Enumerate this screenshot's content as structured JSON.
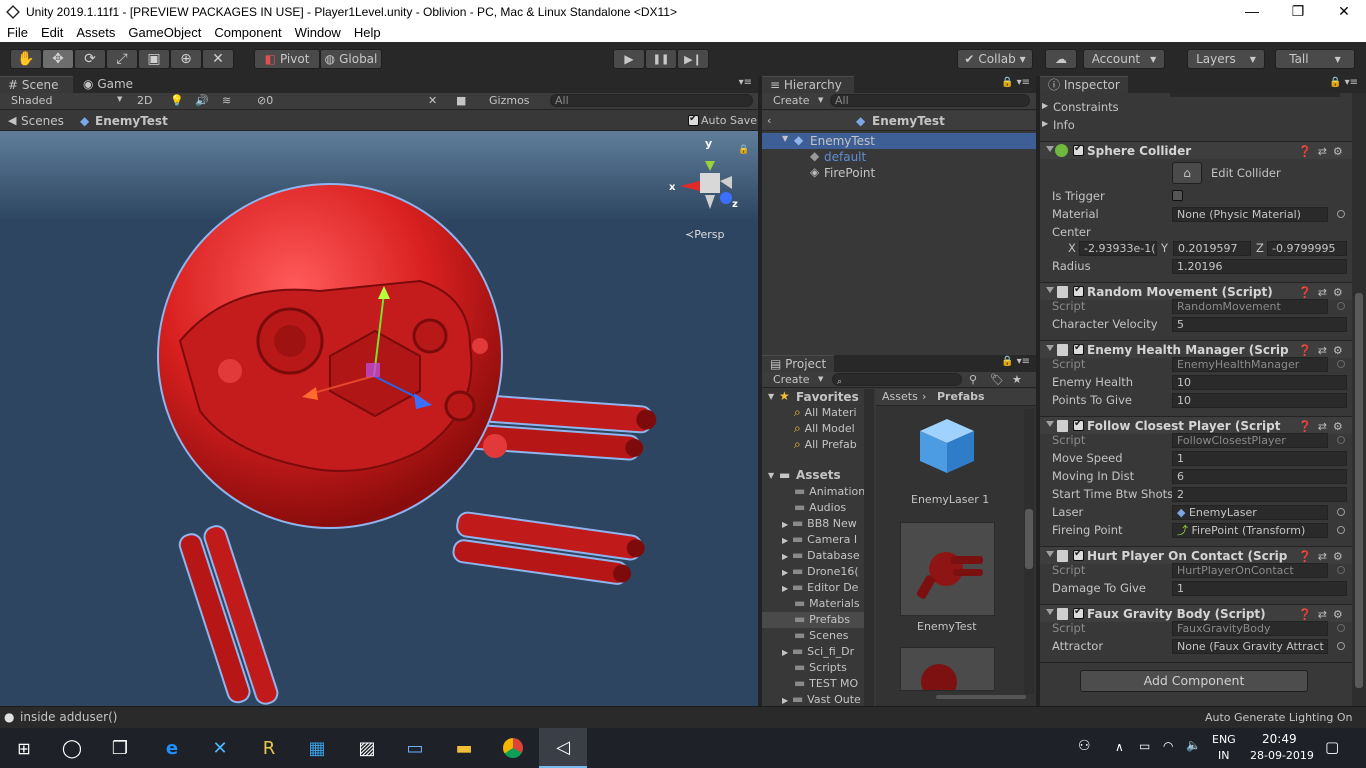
{
  "window": {
    "title": "Unity 2019.1.11f1 - [PREVIEW PACKAGES IN USE] - Player1Level.unity - Oblivion - PC, Mac & Linux Standalone <DX11>",
    "minimize": "—",
    "restore": "❐",
    "close": "✕"
  },
  "menu": [
    "File",
    "Edit",
    "Assets",
    "GameObject",
    "Component",
    "Window",
    "Help"
  ],
  "toolbar": {
    "pivot": "Pivot",
    "global": "Global",
    "collab": "Collab ▾",
    "account": "Account",
    "layers": "Layers",
    "layout": "Tall",
    "play": "▶",
    "pause": "❚❚",
    "step": "▶❙"
  },
  "scene": {
    "tab_scene": "Scene",
    "tab_game": "Game",
    "shading": "Shaded",
    "mode_2d": "2D",
    "hidden_count": "0",
    "gizmos": "Gizmos",
    "search_placeholder": "All",
    "breadcrumb_scenes": "Scenes",
    "breadcrumb_object": "EnemyTest",
    "auto_save": "Auto Save",
    "persp": "Persp",
    "axis_y": "y",
    "axis_x": "x",
    "axis_z": "z"
  },
  "hierarchy": {
    "tab": "Hierarchy",
    "create": "Create",
    "search_placeholder": "All",
    "header": "EnemyTest",
    "items": [
      {
        "label": "EnemyTest",
        "color": "#8fb4ee"
      },
      {
        "label": "default",
        "color": "#5e8fd6"
      },
      {
        "label": "FirePoint",
        "color": "#c4c4c4"
      }
    ]
  },
  "project": {
    "tab": "Project",
    "create": "Create",
    "favorites": "Favorites",
    "favorite_items": [
      "All Materi",
      "All Model",
      "All Prefab"
    ],
    "assets": "Assets",
    "folders": [
      "Animation",
      "Audios",
      "BB8 New",
      "Camera I",
      "Database",
      "Drone16(",
      "Editor De",
      "Materials",
      "Prefabs",
      "Scenes",
      "Sci_fi_Dr",
      "Scripts",
      "TEST MO",
      "Vast Oute"
    ],
    "path": [
      "Assets",
      "Prefabs"
    ],
    "grid_items": [
      "EnemyLaser 1",
      "EnemyTest"
    ]
  },
  "inspector": {
    "tab": "Inspector",
    "top_items": [
      "Constraints",
      "Info"
    ],
    "sphere": {
      "title": "Sphere Collider",
      "edit_collider": "Edit Collider",
      "is_trigger": "Is Trigger",
      "material_label": "Material",
      "material_value": "None (Physic Material)",
      "center_label": "Center",
      "x": "-2.93933e-1(",
      "y": "0.2019597",
      "z": "-0.9799995",
      "radius_label": "Radius",
      "radius_value": "1.20196"
    },
    "random_movement": {
      "title": "Random Movement (Script)",
      "script": "RandomMovement",
      "velocity_label": "Character Velocity",
      "velocity": "5"
    },
    "health": {
      "title": "Enemy Health Manager (Scrip",
      "script": "EnemyHealthManager",
      "health_label": "Enemy Health",
      "health": "10",
      "points_label": "Points To Give",
      "points": "10"
    },
    "follow": {
      "title": "Follow Closest Player (Script",
      "script": "FollowClosestPlayer",
      "move_speed_label": "Move Speed",
      "move_speed": "1",
      "moving_in_dist_label": "Moving In Dist",
      "moving_in_dist": "6",
      "start_time_label": "Start Time Btw Shots",
      "start_time": "2",
      "laser_label": "Laser",
      "laser": "EnemyLaser",
      "firing_point_label": "Fireing Point",
      "firing_point": "FirePoint (Transform)"
    },
    "hurt": {
      "title": "Hurt Player On Contact (Scrip",
      "script": "HurtPlayerOnContact",
      "damage_label": "Damage To Give",
      "damage": "1"
    },
    "gravity": {
      "title": "Faux Gravity Body (Script)",
      "script": "FauxGravityBody",
      "attractor_label": "Attractor",
      "attractor": "None (Faux Gravity Attract"
    },
    "script_label": "Script",
    "add_component": "Add Component"
  },
  "status": {
    "message": "inside adduser()",
    "lighting": "Auto Generate Lighting On"
  },
  "taskbar": {
    "lang_top": "ENG",
    "lang_bottom": "IN",
    "time": "20:49",
    "date": "28-09-2019"
  },
  "colors": {
    "enemy": "#d42a2a",
    "scene_bg": "#2d4560",
    "selection": "#3e5f96"
  }
}
